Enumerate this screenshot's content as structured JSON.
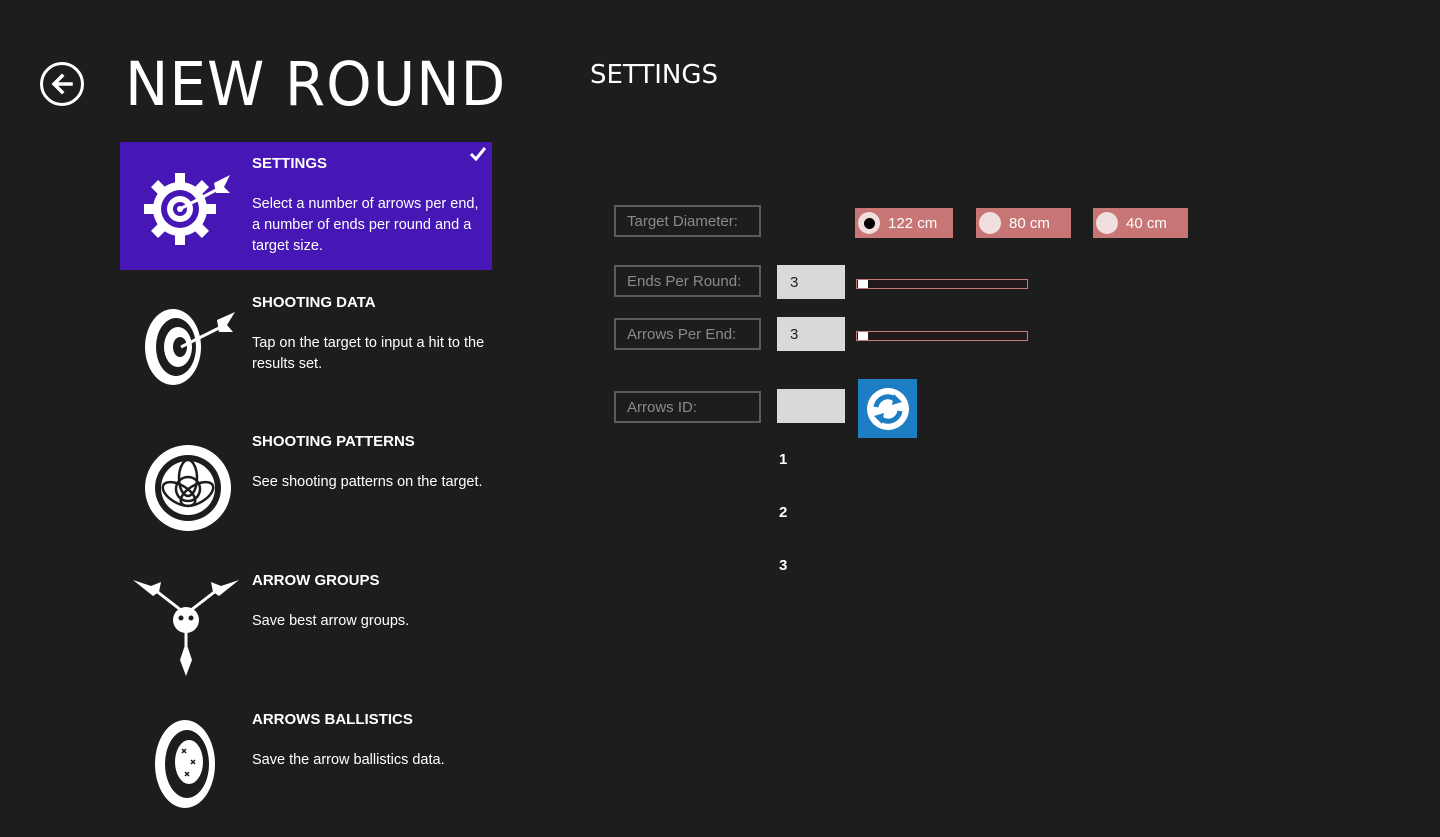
{
  "header": {
    "title": "NEW ROUND",
    "back_icon": "back-arrow-circle-icon"
  },
  "nav": {
    "items": [
      {
        "title": "SETTINGS",
        "desc": "Select a number of arrows per end, a number of ends per round and a target size.",
        "icon": "target-gear-icon",
        "selected": true
      },
      {
        "title": "SHOOTING DATA",
        "desc": "Tap on the target to input a hit to the results set.",
        "icon": "target-arrow-icon"
      },
      {
        "title": "SHOOTING PATTERNS",
        "desc": "See shooting patterns on the target.",
        "icon": "target-pattern-icon"
      },
      {
        "title": "ARROW GROUPS",
        "desc": "Save best arrow groups.",
        "icon": "arrow-group-icon"
      },
      {
        "title": "ARROWS BALLISTICS",
        "desc": "Save the arrow ballistics data.",
        "icon": "target-ballistics-icon"
      }
    ],
    "selected_color": "#4617b4"
  },
  "settings": {
    "title": "SETTINGS",
    "target_diameter": {
      "label": "Target Diameter:",
      "options": [
        {
          "label": "122 cm",
          "selected": true
        },
        {
          "label": "80 cm",
          "selected": false
        },
        {
          "label": "40 cm",
          "selected": false
        }
      ]
    },
    "ends_per_round": {
      "label": "Ends Per Round:",
      "value": "3"
    },
    "arrows_per_end": {
      "label": "Arrows Per End:",
      "value": "3"
    },
    "arrows_id": {
      "label": "Arrows ID:",
      "value": ""
    },
    "arrow_numbers": [
      "1",
      "2",
      "3"
    ]
  },
  "colors": {
    "background": "#1d1d1d",
    "radio_bg": "#c87575",
    "refresh_bg": "#1e7ec4"
  }
}
